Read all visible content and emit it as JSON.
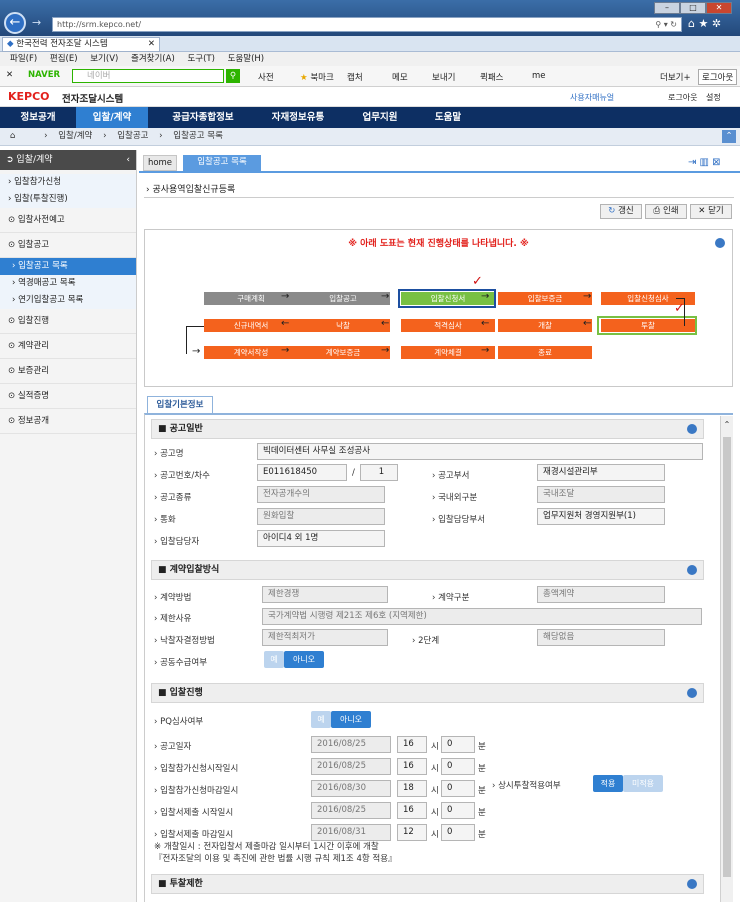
{
  "browser": {
    "url": "http://srm.kepco.net/",
    "tab_title": "한국전력 전자조달 시스템",
    "tab_close": "✕",
    "menu": [
      "파일(F)",
      "편집(E)",
      "보기(V)",
      "즐겨찾기(A)",
      "도구(T)",
      "도움말(H)"
    ],
    "naver_logo": "NAVER",
    "search_placeholder": "네이버",
    "toolbar": [
      "사전",
      "북마크",
      "캡처",
      "메모",
      "보내기",
      "퀵패스",
      "me"
    ],
    "more": "더보기+",
    "login": "로그아웃"
  },
  "app": {
    "logo": "KEPCO",
    "title": "전자조달시스템",
    "user_manual": "사용자매뉴얼",
    "logout": "로그아웃",
    "settings": "설정"
  },
  "mainnav": [
    "정보공개",
    "입찰/계약",
    "공급자종합정보",
    "자재정보유통",
    "업무지원",
    "도움말"
  ],
  "breadcrumb": [
    "입찰/계약",
    "입찰공고",
    "입찰공고 목록"
  ],
  "sidebar": {
    "header": "입찰/계약",
    "items": [
      {
        "label": "입찰참가신청",
        "type": "sub0"
      },
      {
        "label": "입찰(투찰진행)",
        "type": "sub0"
      },
      {
        "label": "입찰사전예고",
        "type": "top"
      },
      {
        "label": "입찰공고",
        "type": "top"
      },
      {
        "label": "입찰공고 목록",
        "type": "active"
      },
      {
        "label": "역경매공고 목록",
        "type": "sub"
      },
      {
        "label": "연기입찰공고 목록",
        "type": "sub"
      },
      {
        "label": "입찰진행",
        "type": "top"
      },
      {
        "label": "계약관리",
        "type": "top"
      },
      {
        "label": "보증관리",
        "type": "top"
      },
      {
        "label": "실적증명",
        "type": "top"
      },
      {
        "label": "정보공개",
        "type": "top"
      }
    ]
  },
  "tabs": [
    "home",
    "입찰공고 목록"
  ],
  "page_title": "공사용역입찰신규등록",
  "buttons": {
    "refresh": "갱신",
    "print": "인쇄",
    "close": "닫기"
  },
  "flow": {
    "notice": "※ 아래 도표는 현재 진행상태를 나타냅니다. ※",
    "steps": [
      "구매계획",
      "입찰공고",
      "입찰신청서",
      "입찰보증금",
      "입찰신청심사",
      "투찰",
      "개찰",
      "적격심사",
      "낙찰",
      "신규내역서",
      "계약서작성",
      "계약보증금",
      "계약체결",
      "종료"
    ]
  },
  "section_tab": "입찰기본정보",
  "general": {
    "title": "공고일반",
    "notice_name_label": "공고명",
    "notice_name": "빅데이터센터 사무실 조성공사",
    "notice_no_label": "공고번호/차수",
    "notice_no": "E011618450",
    "slash": "/",
    "round": "1",
    "dept_label": "공고부서",
    "dept": "재경시설관리부",
    "type_label": "공고종류",
    "type": "전자공개수의",
    "domestic_label": "국내외구분",
    "domestic": "국내조달",
    "currency_label": "통화",
    "currency": "원화입찰",
    "manager_dept_label": "입찰담당부서",
    "manager_dept": "업무지원처 경영지원부(1)",
    "manager_label": "입찰담당자",
    "manager": "아이디4 외 1명"
  },
  "contract": {
    "title": "계약입찰방식",
    "method_label": "계약방법",
    "method": "제한경쟁",
    "category_label": "계약구분",
    "category": "총액계약",
    "reason_label": "제한사유",
    "reason": "국가계약법 시행령 제21조 제6호 (지역제한)",
    "award_label": "낙찰자결정방법",
    "award": "제한적최저가",
    "two_stage_label": "2단계",
    "two_stage": "해당없음",
    "joint_label": "공동수급여부",
    "yes": "예",
    "no": "아니오"
  },
  "progress": {
    "title": "입찰진행",
    "pq_label": "PQ심사여부",
    "yes": "예",
    "no": "아니오",
    "hour_unit": "시",
    "min_unit": "분",
    "rows": [
      {
        "label": "공고일자",
        "date": "2016/08/25",
        "hour": "16",
        "min": "0"
      },
      {
        "label": "입찰참가신청시작일시",
        "date": "2016/08/25",
        "hour": "16",
        "min": "0"
      },
      {
        "label": "입찰참가신청마감일시",
        "date": "2016/08/30",
        "hour": "18",
        "min": "0"
      },
      {
        "label": "입찰서제출 시작일시",
        "date": "2016/08/25",
        "hour": "16",
        "min": "0"
      },
      {
        "label": "입찰서제출 마감일시",
        "date": "2016/08/31",
        "hour": "12",
        "min": "0"
      }
    ],
    "always_label": "상시투찰적용여부",
    "apply": "적용",
    "not_apply": "미적용",
    "note1": "※ 개찰일시 : 전자입찰서 제출마감 일시부터 1시간 이후에 개찰",
    "note2": "『전자조달의 이용 및 촉진에 관한 법률 시행 규칙 제1조 4항 적용』"
  },
  "restriction": {
    "title": "투찰제한"
  }
}
